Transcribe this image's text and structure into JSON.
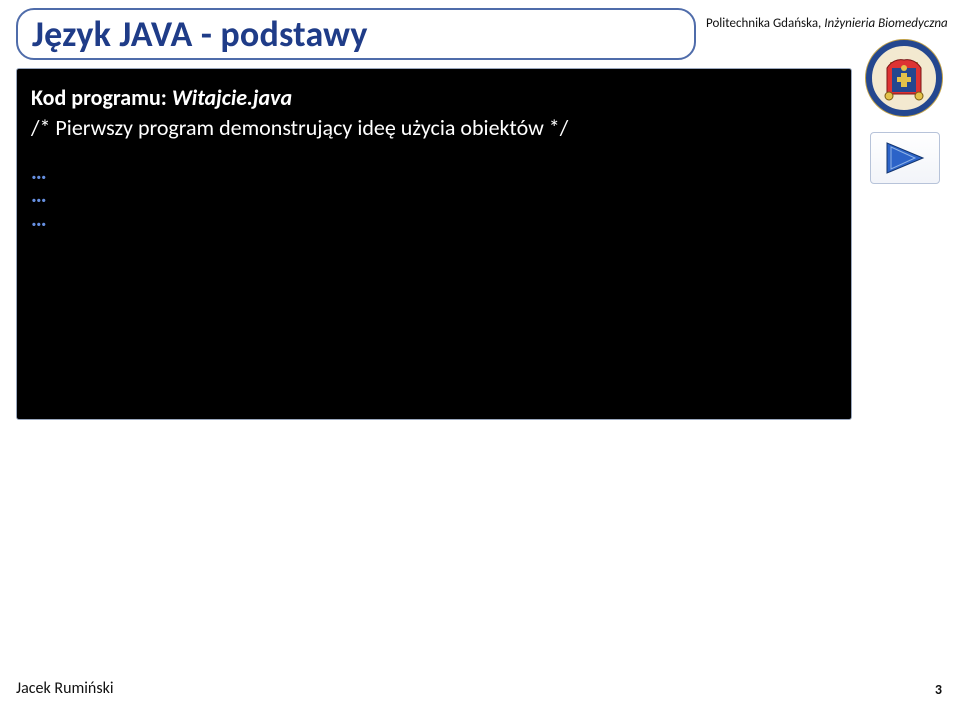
{
  "title": "Język JAVA - podstawy",
  "header_sub": {
    "prefix": "Politechnika Gdańska, ",
    "italic": "Inżynieria Biomedyczna"
  },
  "code": {
    "line1_label": "Kod programu: ",
    "line1_file": "Witajcie.java",
    "line2": "/* Pierwszy program demonstrujący ideę użycia obiektów */",
    "dots1": "…",
    "dots2": "…",
    "dots3": "…"
  },
  "footer": {
    "author": "Jacek Rumiński",
    "page": "3"
  }
}
